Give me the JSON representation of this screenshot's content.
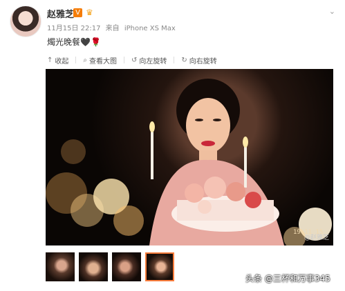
{
  "header": {
    "username": "赵雅芝",
    "vip_icon": "v-icon",
    "badge_icon": "crown-icon",
    "menu_icon": "chevron-down-icon",
    "timestamp": "11月15日 22:17",
    "source_prefix": "来自",
    "source_device": "iPhone XS Max"
  },
  "post": {
    "caption": "燭光晚餐🖤🌹"
  },
  "toolbar": {
    "collapse": "收起",
    "view_large": "查看大图",
    "rotate_left": "向左旋转",
    "rotate_right": "向右旋转"
  },
  "photo": {
    "date_stamp": "19 11 15",
    "watermark": "@赵雅芝"
  },
  "thumbnails": [
    {
      "label": "thumb-1"
    },
    {
      "label": "thumb-2"
    },
    {
      "label": "thumb-3"
    },
    {
      "label": "thumb-4",
      "selected": true
    }
  ],
  "attribution": "头条 @三杯和万事345",
  "colors": {
    "accent": "#fa7d3c",
    "text_main": "#333333",
    "text_meta": "#888888"
  }
}
